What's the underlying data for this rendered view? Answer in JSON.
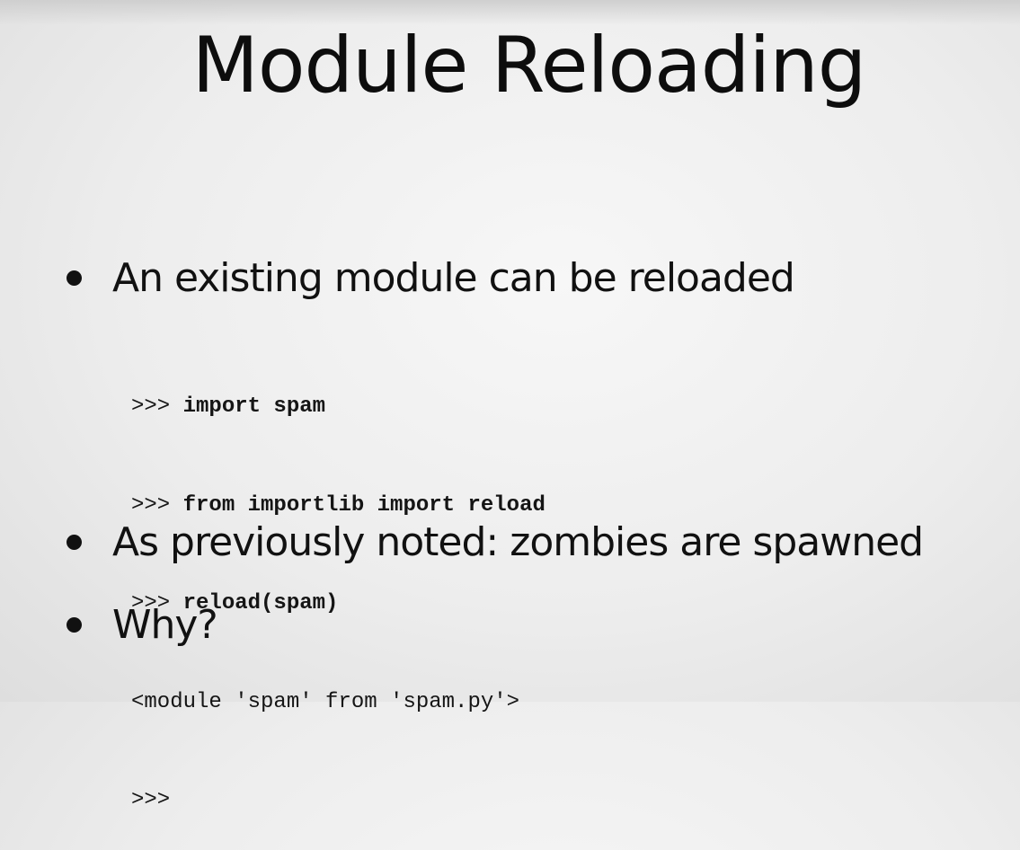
{
  "title": "Module Reloading",
  "bullets": [
    {
      "text": "An existing module can be reloaded"
    },
    {
      "text": "As previously noted: zombies are spawned"
    },
    {
      "text": "Why?"
    }
  ],
  "code": {
    "lines": [
      {
        "prompt": ">>> ",
        "command": "import spam",
        "output": ""
      },
      {
        "prompt": ">>> ",
        "command": "from importlib import reload",
        "output": ""
      },
      {
        "prompt": ">>> ",
        "command": "reload(spam)",
        "output": ""
      },
      {
        "prompt": "",
        "command": "",
        "output": "<module 'spam' from 'spam.py'>"
      },
      {
        "prompt": ">>>",
        "command": "",
        "output": ""
      }
    ]
  }
}
